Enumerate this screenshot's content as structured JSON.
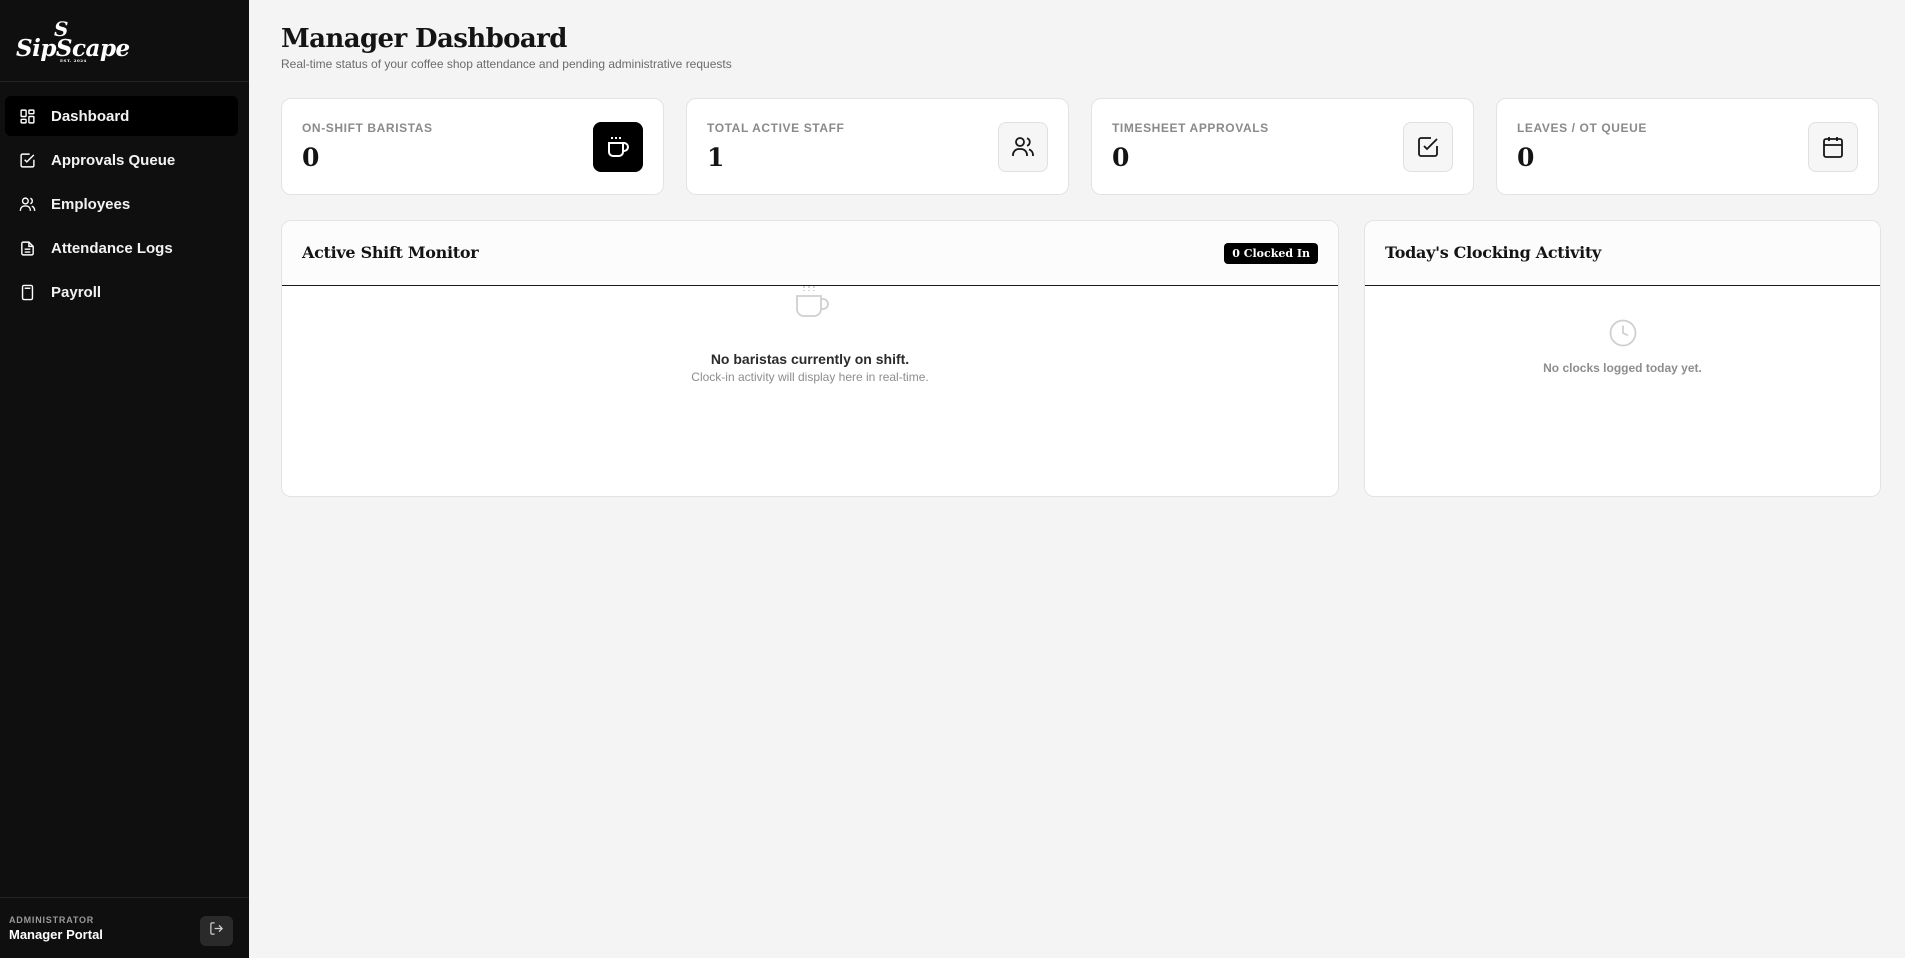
{
  "brand": {
    "name": "SipScape",
    "mark": "S",
    "est": "EST. 2024"
  },
  "sidebar": {
    "items": [
      {
        "label": "Dashboard",
        "icon": "grid-icon",
        "active": true
      },
      {
        "label": "Approvals Queue",
        "icon": "checkbox-icon",
        "active": false
      },
      {
        "label": "Employees",
        "icon": "users-icon",
        "active": false
      },
      {
        "label": "Attendance Logs",
        "icon": "document-icon",
        "active": false
      },
      {
        "label": "Payroll",
        "icon": "calculator-icon",
        "active": false
      }
    ],
    "footer": {
      "role": "ADMINISTRATOR",
      "portal": "Manager Portal",
      "logout_icon": "logout-icon"
    }
  },
  "header": {
    "title": "Manager Dashboard",
    "subtitle": "Real-time status of your coffee shop attendance and pending administrative requests"
  },
  "stats": [
    {
      "label": "ON-SHIFT BARISTAS",
      "value": "0",
      "icon": "coffee-icon"
    },
    {
      "label": "TOTAL ACTIVE STAFF",
      "value": "1",
      "icon": "users-icon"
    },
    {
      "label": "TIMESHEET APPROVALS",
      "value": "0",
      "icon": "checkbox-icon"
    },
    {
      "label": "LEAVES / OT QUEUE",
      "value": "0",
      "icon": "calendar-icon"
    }
  ],
  "shift_monitor": {
    "title": "Active Shift Monitor",
    "badge": "0 Clocked In",
    "empty_title": "No baristas currently on shift.",
    "empty_sub": "Clock-in activity will display here in real-time.",
    "empty_icon": "coffee-cup-icon"
  },
  "clocking": {
    "title": "Today's Clocking Activity",
    "empty_text": "No clocks logged today yet.",
    "empty_icon": "clock-icon"
  },
  "colors": {
    "sidebar_bg": "#0f0f0f",
    "page_bg": "#f4f4f4",
    "accent": "#000000"
  }
}
